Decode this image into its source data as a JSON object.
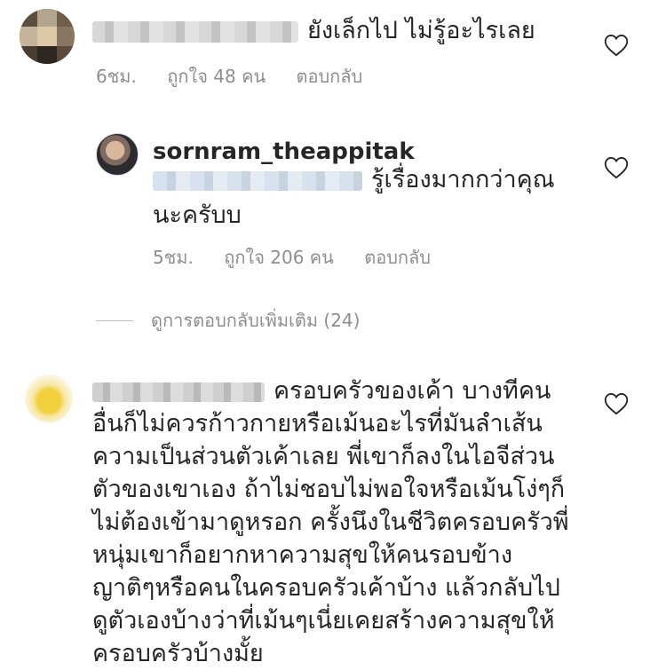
{
  "comments": [
    {
      "text": "ยังเล็กไป ไม่รู้อะไรเลย",
      "time": "6ชม.",
      "likes": "ถูกใจ 48 คน",
      "reply": "ตอบกลับ"
    }
  ],
  "reply": {
    "username": "sornram_theappitak",
    "text": "รู้เรื่องมากกว่าคุณนะครับบ",
    "line1": "รู้เรื่องมากกว่าคุณ",
    "line2": "นะครับบ",
    "time": "5ชม.",
    "likes": "ถูกใจ 206 คน",
    "reply": "ตอบกลับ"
  },
  "more_replies": "ดูการตอบกลับเพิ่มเติม (24)",
  "comment3": {
    "lines": [
      "ครอบครัวของเค้า บางทีคน",
      "อื่นก็ไม่ควรก้าวกายหรือเม้นอะไรที่มันลำเส้น",
      "ความเป็นส่วนตัวเค้าเลย พี่เขาก็ลงในไอจีส่วน",
      "ตัวของเขาเอง ถ้าไม่ชอบไม่พอใจหรือเม้นโง่ๆก็",
      "ไม่ต้องเข้ามาดูหรอก ครั้งนึงในชีวิตครอบครัวพี่",
      "หนุ่มเขาก็อยากหาความสุขให้คนรอบข้าง",
      "ญาติๆหรือคนในครอบครัวเค้าบ้าง แล้วกลับไป",
      "ดูตัวเองบ้างว่าที่เม้นๆเนี่ยเคยสร้างความสุขให้",
      "ครอบครัวบ้างมั้ย"
    ]
  },
  "icons": {
    "heart": "heart-outline-icon"
  },
  "colors": {
    "text": "#262626",
    "meta": "#8e8e8e"
  }
}
